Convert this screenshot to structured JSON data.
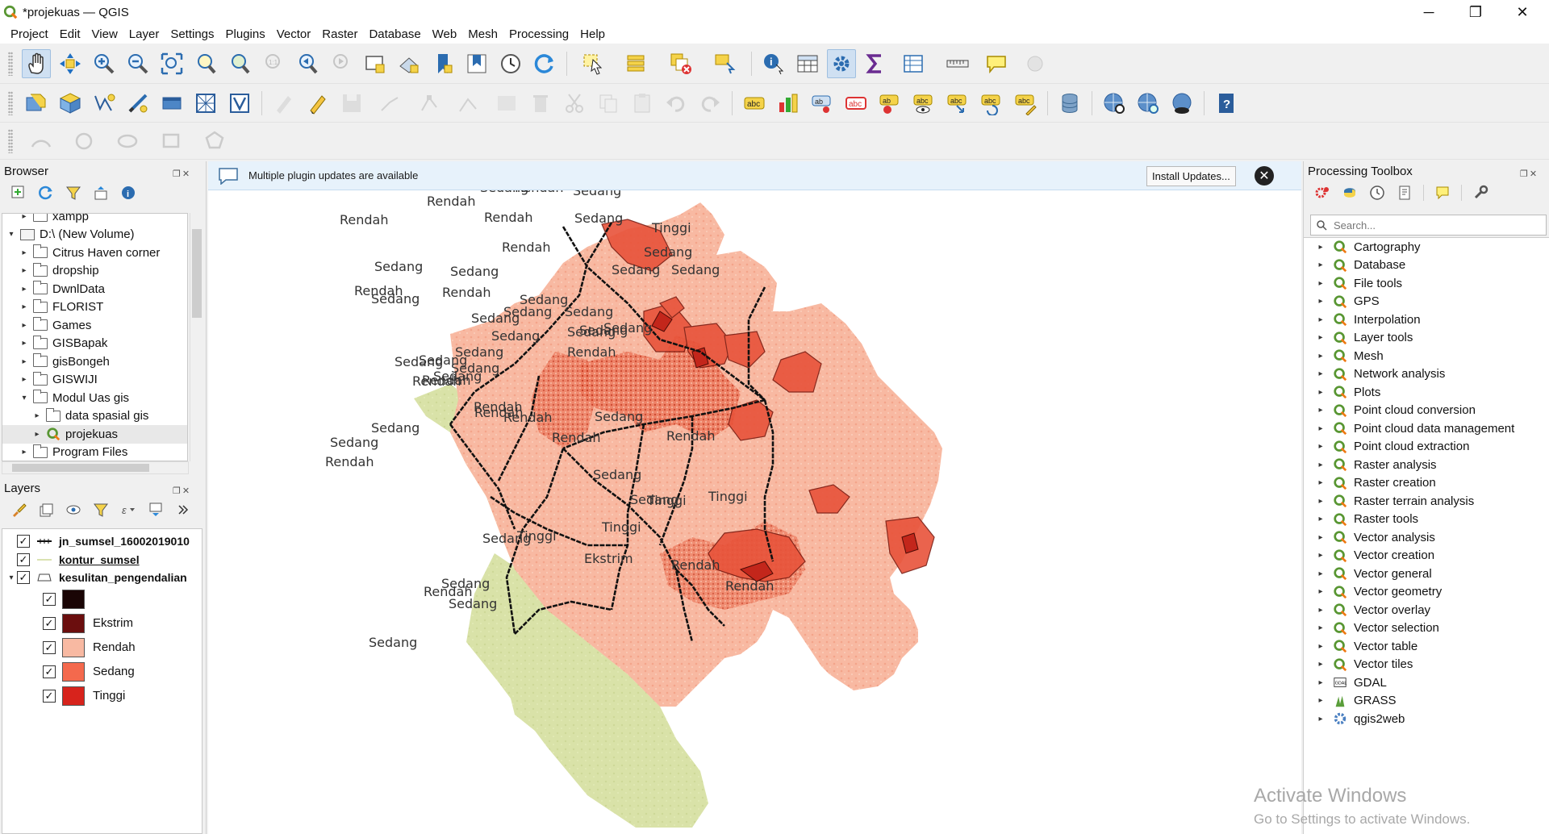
{
  "window": {
    "title": "*projekuas — QGIS",
    "controls": [
      "─",
      "❐",
      "✕"
    ]
  },
  "menu": [
    "Project",
    "Edit",
    "View",
    "Layer",
    "Settings",
    "Plugins",
    "Vector",
    "Raster",
    "Database",
    "Web",
    "Mesh",
    "Processing",
    "Help"
  ],
  "browser": {
    "title": "Browser",
    "items": [
      {
        "label": "xampp",
        "kind": "folder",
        "level": 1,
        "caret": "▸"
      },
      {
        "label": "D:\\ (New Volume)",
        "kind": "drive",
        "level": 0,
        "caret": "▾"
      },
      {
        "label": "Citrus Haven corner",
        "kind": "folder",
        "level": 1,
        "caret": "▸"
      },
      {
        "label": "dropship",
        "kind": "folder",
        "level": 1,
        "caret": "▸"
      },
      {
        "label": "DwnlData",
        "kind": "folder",
        "level": 1,
        "caret": "▸"
      },
      {
        "label": "FLORIST",
        "kind": "folder",
        "level": 1,
        "caret": "▸"
      },
      {
        "label": "Games",
        "kind": "folder",
        "level": 1,
        "caret": "▸"
      },
      {
        "label": "GISBapak",
        "kind": "folder",
        "level": 1,
        "caret": "▸"
      },
      {
        "label": "gisBongeh",
        "kind": "folder",
        "level": 1,
        "caret": "▸"
      },
      {
        "label": "GISWIJI",
        "kind": "folder",
        "level": 1,
        "caret": "▸"
      },
      {
        "label": "Modul Uas gis",
        "kind": "folder",
        "level": 1,
        "caret": "▾"
      },
      {
        "label": "data spasial gis",
        "kind": "folder",
        "level": 2,
        "caret": "▸"
      },
      {
        "label": "projekuas",
        "kind": "qgis",
        "level": 2,
        "caret": "▸"
      },
      {
        "label": "Program Files",
        "kind": "folder",
        "level": 1,
        "caret": "▸"
      }
    ]
  },
  "layers": {
    "title": "Layers",
    "items": [
      {
        "name": "jn_sumsel_16002019010",
        "checked": true,
        "bold": true,
        "underline": false,
        "icon": "line"
      },
      {
        "name": "kontur_sumsel",
        "checked": true,
        "bold": true,
        "underline": true,
        "icon": "line-thin"
      },
      {
        "name": "kesulitan_pengendalian",
        "checked": true,
        "bold": true,
        "underline": false,
        "icon": "polygon"
      }
    ],
    "legend": [
      {
        "label": "",
        "color": "#1a0505"
      },
      {
        "label": "Ekstrim",
        "color": "#6b0e0e"
      },
      {
        "label": "Rendah",
        "color": "#f8b9a2"
      },
      {
        "label": "Sedang",
        "color": "#f4694d"
      },
      {
        "label": "Tinggi",
        "color": "#d7231c"
      }
    ]
  },
  "message_bar": {
    "text": "Multiple plugin updates are available",
    "button": "Install Updates...",
    "close": "✕"
  },
  "map": {
    "labels": [
      "Tinggi",
      "Rendah",
      "Sedang",
      "Sedang",
      "Sedang",
      "Sedang",
      "Sedang",
      "Sedang",
      "Sedang",
      "Rendah",
      "Rendah",
      "Rendah",
      "Sedang",
      "Rendah",
      "Sedang",
      "Sedang",
      "Sedang",
      "Sedang",
      "Sedang",
      "Sedang",
      "Rendah",
      "Rendah",
      "Tinggi",
      "Sedang",
      "Rendah",
      "Sedang",
      "Sedang",
      "Sedang",
      "Sedang",
      "Rendah",
      "Sedang",
      "Rendah",
      "Sedang",
      "Sedang",
      "Sedang",
      "Sedang",
      "Sedang",
      "Sedang",
      "Sedang",
      "Rendah",
      "Sedang",
      "Sedang",
      "Rendah",
      "Sedang",
      "Sedang",
      "Sedang",
      "Rendah",
      "Sedang",
      "Rendah",
      "Sedang",
      "Sedang",
      "Rendah",
      "Rendah",
      "Rendah",
      "Sedang",
      "Rendah",
      "Sedang",
      "Sedang",
      "Tinggi",
      "Ekstrim",
      "Rendah",
      "Tinggi",
      "Tinggi",
      "Rendah",
      "Rendah",
      "Sedang",
      "Tinggi",
      "Rendah",
      "Sedang",
      "Sedang",
      "Sedang"
    ],
    "colors": {
      "low": "#d9e2a8",
      "rendah": "#f8b9a2",
      "sedang": "#f4694d",
      "tinggi": "#d7231c",
      "road": "#111111"
    }
  },
  "toolbox": {
    "title": "Processing Toolbox",
    "search_placeholder": "Search...",
    "items": [
      {
        "label": "Cartography",
        "icon": "qgis"
      },
      {
        "label": "Database",
        "icon": "qgis"
      },
      {
        "label": "File tools",
        "icon": "qgis"
      },
      {
        "label": "GPS",
        "icon": "qgis"
      },
      {
        "label": "Interpolation",
        "icon": "qgis"
      },
      {
        "label": "Layer tools",
        "icon": "qgis"
      },
      {
        "label": "Mesh",
        "icon": "qgis"
      },
      {
        "label": "Network analysis",
        "icon": "qgis"
      },
      {
        "label": "Plots",
        "icon": "qgis"
      },
      {
        "label": "Point cloud conversion",
        "icon": "qgis"
      },
      {
        "label": "Point cloud data management",
        "icon": "qgis"
      },
      {
        "label": "Point cloud extraction",
        "icon": "qgis"
      },
      {
        "label": "Raster analysis",
        "icon": "qgis"
      },
      {
        "label": "Raster creation",
        "icon": "qgis"
      },
      {
        "label": "Raster terrain analysis",
        "icon": "qgis"
      },
      {
        "label": "Raster tools",
        "icon": "qgis"
      },
      {
        "label": "Vector analysis",
        "icon": "qgis"
      },
      {
        "label": "Vector creation",
        "icon": "qgis"
      },
      {
        "label": "Vector general",
        "icon": "qgis"
      },
      {
        "label": "Vector geometry",
        "icon": "qgis"
      },
      {
        "label": "Vector overlay",
        "icon": "qgis"
      },
      {
        "label": "Vector selection",
        "icon": "qgis"
      },
      {
        "label": "Vector table",
        "icon": "qgis"
      },
      {
        "label": "Vector tiles",
        "icon": "qgis"
      },
      {
        "label": "GDAL",
        "icon": "gdal"
      },
      {
        "label": "GRASS",
        "icon": "grass"
      },
      {
        "label": "qgis2web",
        "icon": "gear"
      }
    ]
  },
  "watermark": {
    "line1": "Activate Windows",
    "line2": "Go to Settings to activate Windows."
  }
}
